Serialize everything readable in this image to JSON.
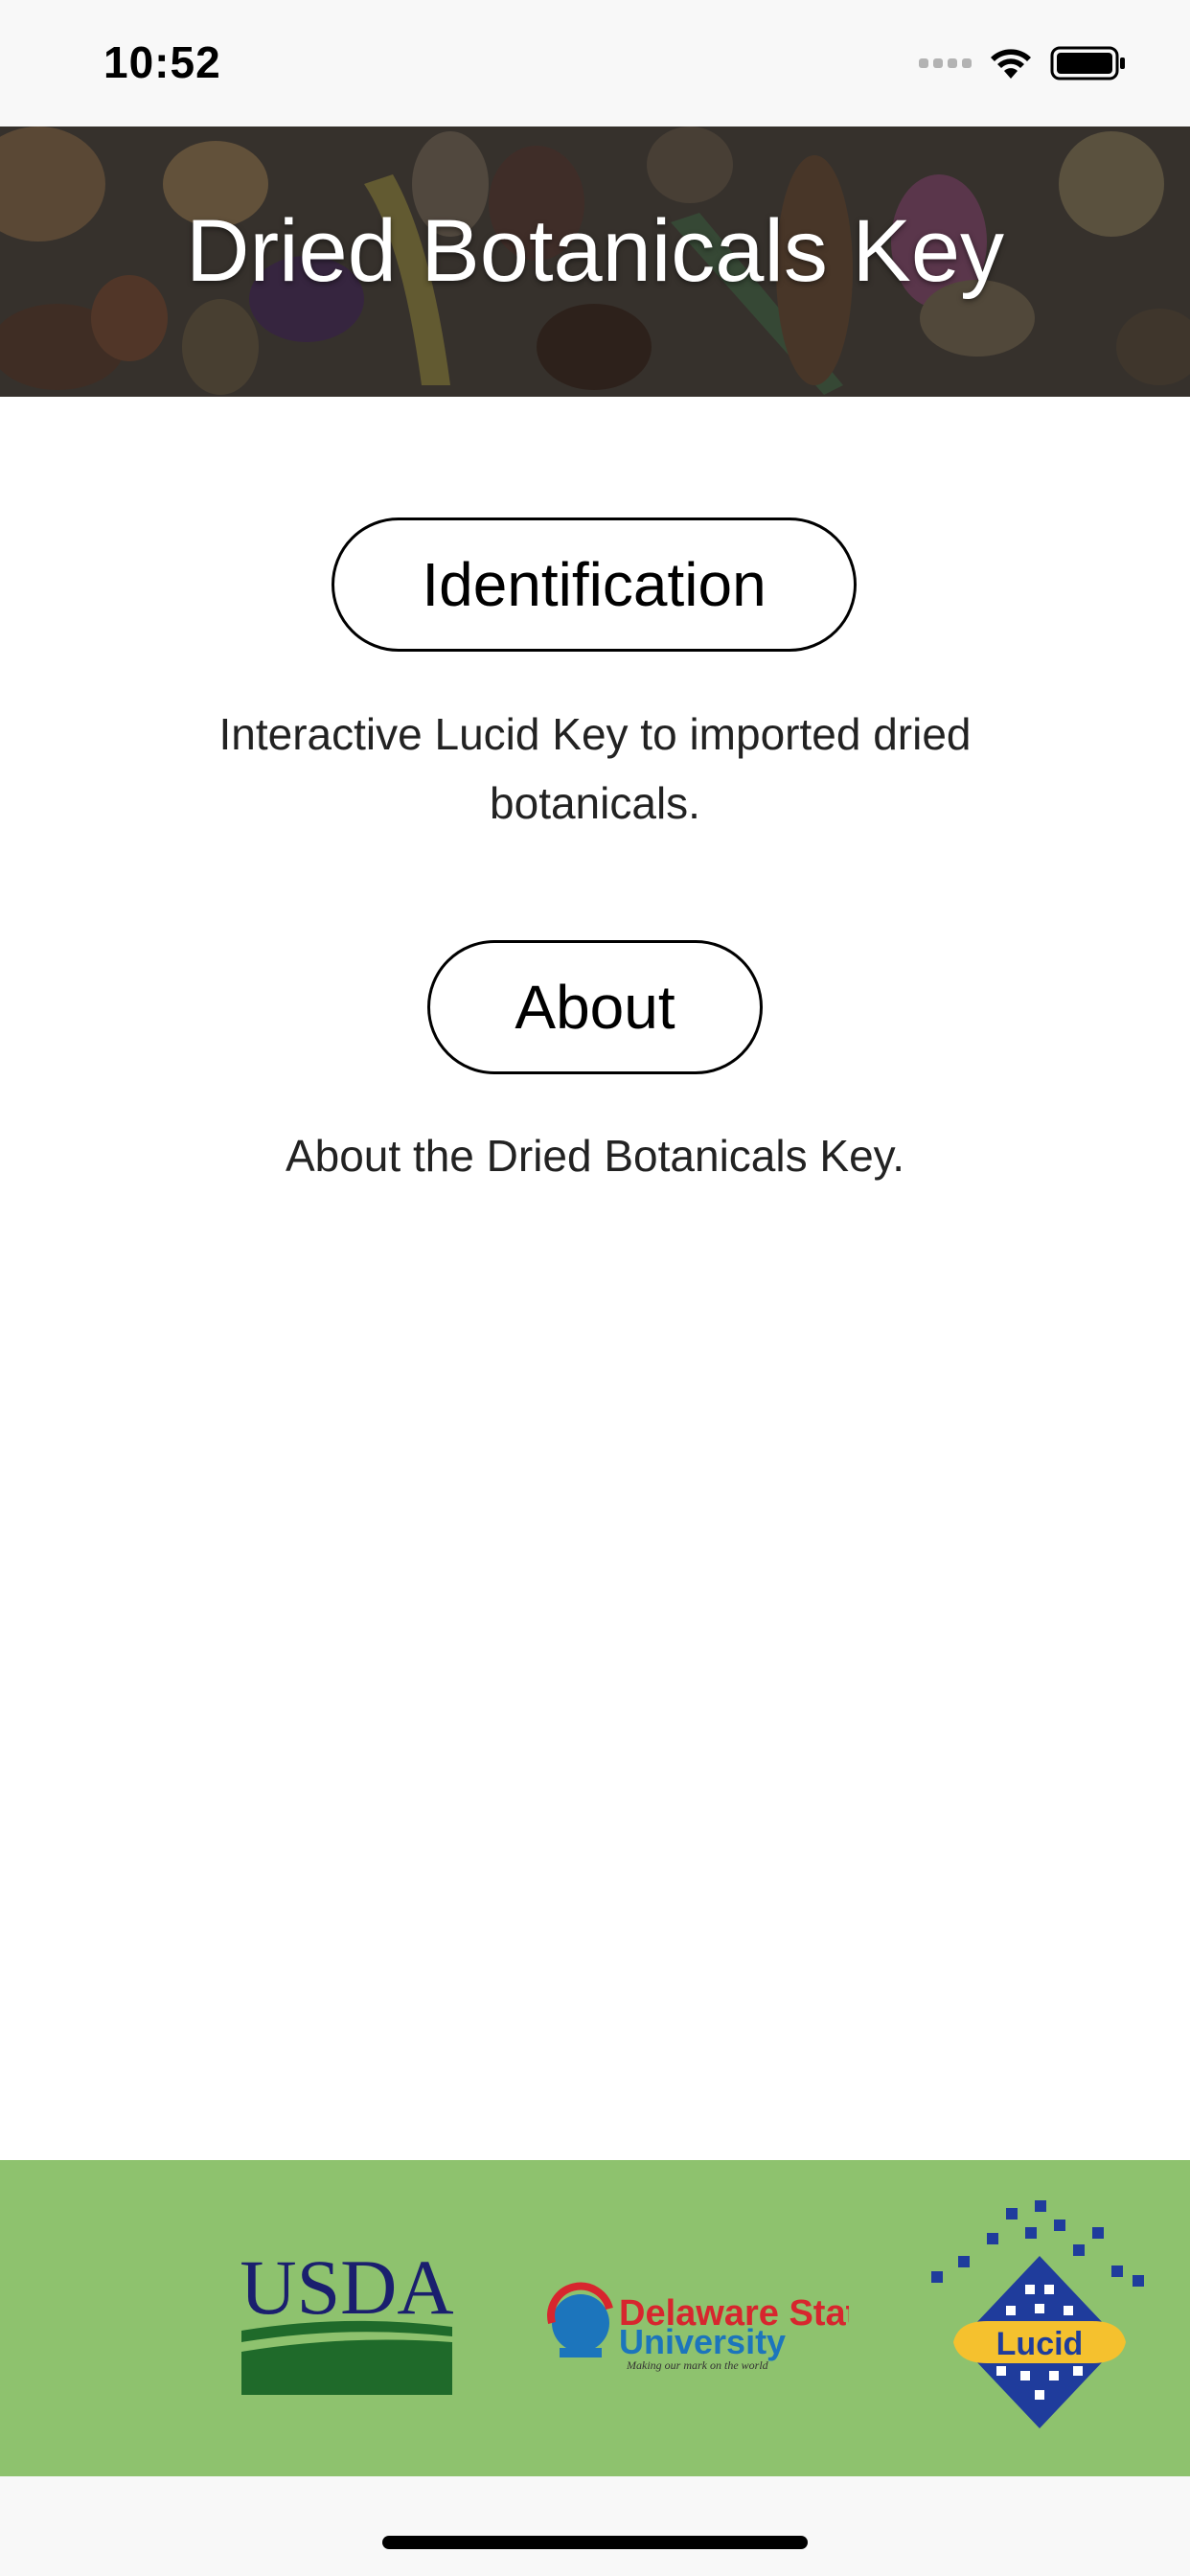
{
  "status_bar": {
    "time": "10:52",
    "icons": [
      "signal-dots-icon",
      "wifi-icon",
      "battery-icon"
    ]
  },
  "header": {
    "title": "Dried Botanicals Key"
  },
  "menu": {
    "identification": {
      "label": "Identification",
      "description": "Interactive Lucid Key to imported dried botanicals."
    },
    "about": {
      "label": "About",
      "description": "About the Dried Botanicals Key."
    }
  },
  "footer": {
    "background": "#8ec26e",
    "logos": {
      "usda": "USDA",
      "dsu_line1": "Delaware State",
      "dsu_line2": "University",
      "dsu_tagline": "Making our mark on the world",
      "lucid": "Lucid"
    }
  },
  "colors": {
    "header_title": "#ffffff",
    "button_border": "#000000",
    "usda_blue": "#1a1f6e",
    "usda_green": "#1f6a2a",
    "dsu_red": "#d7262e",
    "dsu_blue": "#1c75bc",
    "lucid_blue": "#1f3c9c",
    "lucid_yellow": "#f5c12e"
  }
}
